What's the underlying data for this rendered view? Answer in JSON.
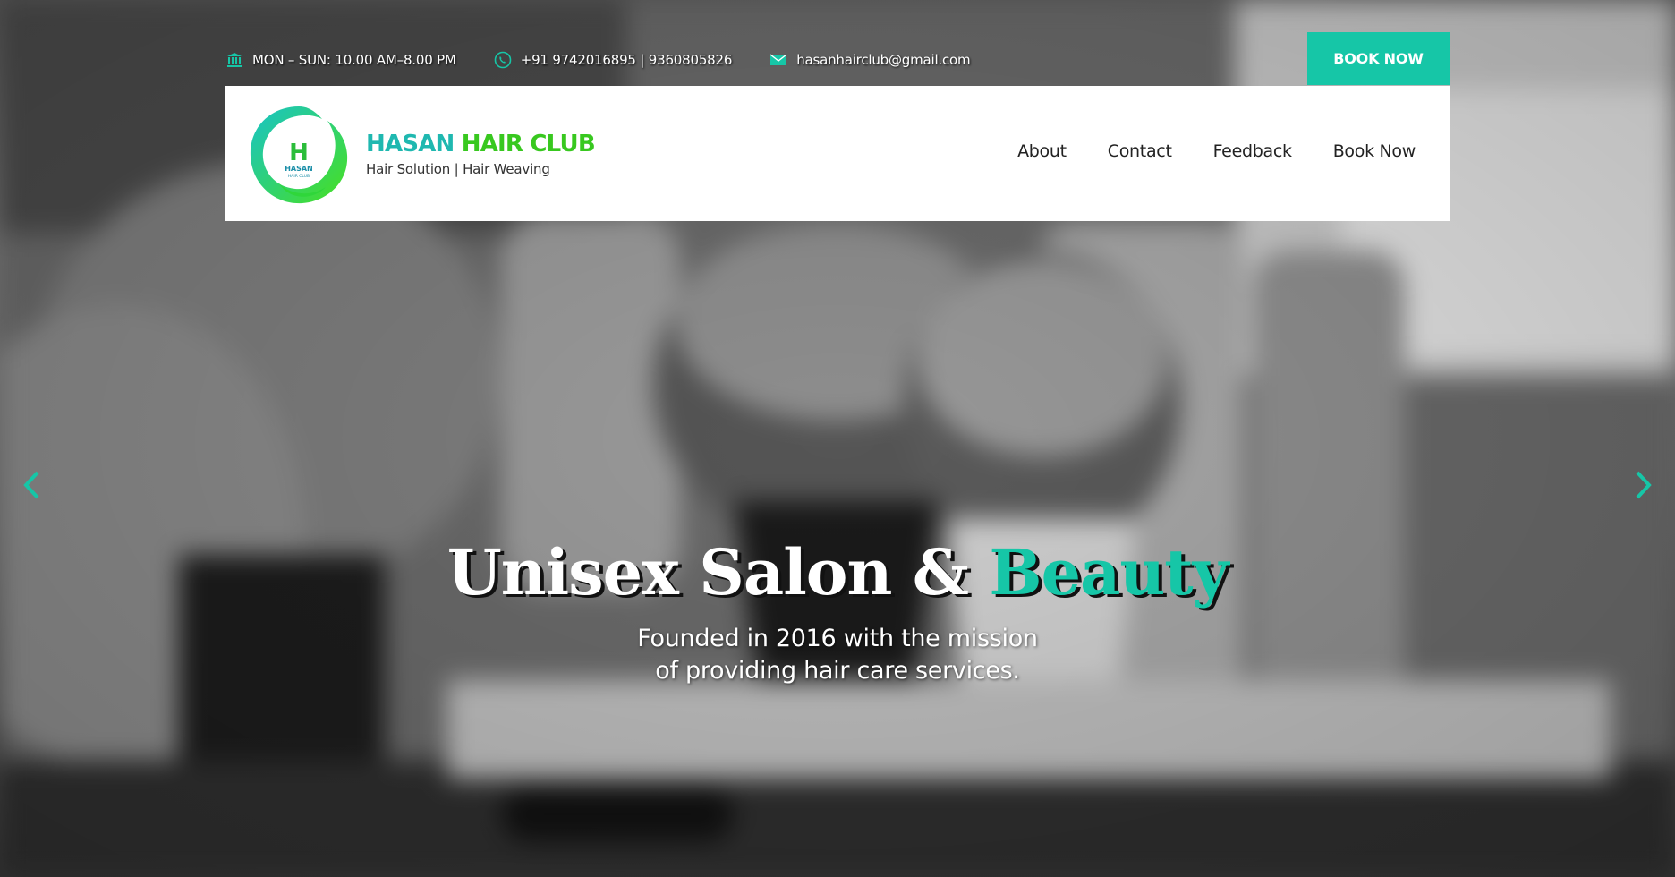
{
  "topbar": {
    "hours_icon": "bank-icon",
    "hours": "MON – SUN: 10.00 AM–8.00 PM",
    "phone_icon": "phone-icon",
    "phone": "+91 9742016895 | 9360805826",
    "email_icon": "mail-icon",
    "email": "hasanhairclub@gmail.com",
    "cta_label": "BOOK NOW"
  },
  "header": {
    "logo_icon": "hasan-hair-club-logo",
    "logo_letters": "H",
    "logo_text": "HASAN",
    "logo_subtext": "HAIR CLUB",
    "brand_part1": "HASAN",
    "brand_part2": "HAIR CLUB",
    "tagline": "Hair Solution | Hair Weaving",
    "nav": [
      {
        "label": "About"
      },
      {
        "label": "Contact"
      },
      {
        "label": "Feedback"
      },
      {
        "label": "Book Now"
      }
    ]
  },
  "hero": {
    "headline_main": "Unisex Salon & ",
    "headline_accent": "Beauty",
    "subtext_line1": "Founded in 2016 with the mission",
    "subtext_line2": "of providing hair care services.",
    "prev_icon": "chevron-left-icon",
    "next_icon": "chevron-right-icon"
  },
  "colors": {
    "accent": "#16c6a7",
    "brand_teal": "#1fb8b0",
    "brand_green": "#38c81f",
    "header_bg": "#ffffff",
    "nav_text": "#222222"
  }
}
